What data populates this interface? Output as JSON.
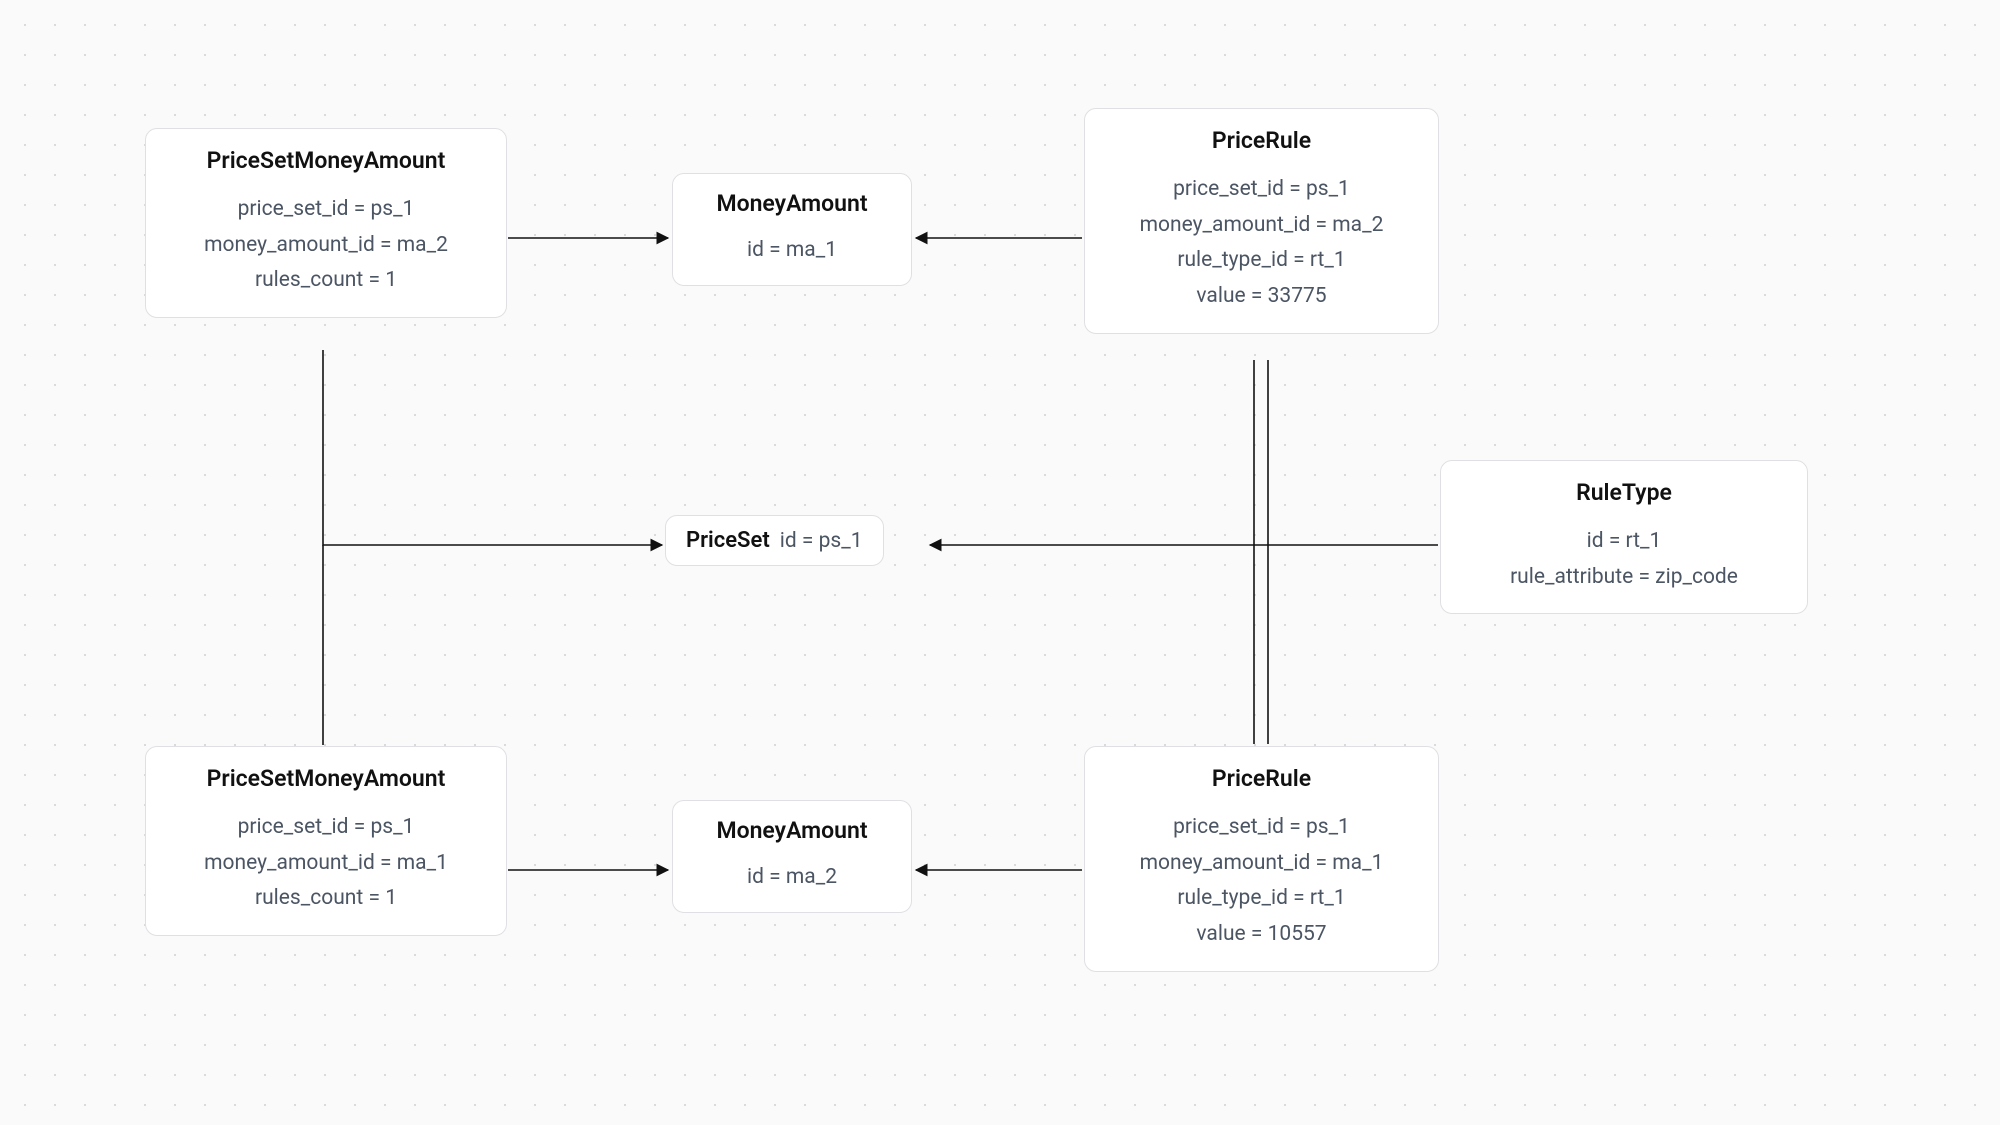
{
  "nodes": {
    "psma1": {
      "title": "PriceSetMoneyAmount",
      "attrs": {
        "price_set_id": "price_set_id = ps_1",
        "money_amount_id": "money_amount_id = ma_2",
        "rules_count": "rules_count = 1"
      }
    },
    "psma2": {
      "title": "PriceSetMoneyAmount",
      "attrs": {
        "price_set_id": "price_set_id = ps_1",
        "money_amount_id": "money_amount_id = ma_1",
        "rules_count": "rules_count = 1"
      }
    },
    "money1": {
      "title": "MoneyAmount",
      "attrs": {
        "id": "id = ma_1"
      }
    },
    "money2": {
      "title": "MoneyAmount",
      "attrs": {
        "id": "id = ma_2"
      }
    },
    "priceset": {
      "title": "PriceSet",
      "attrs": {
        "id": "id = ps_1"
      }
    },
    "pricerule1": {
      "title": "PriceRule",
      "attrs": {
        "price_set_id": "price_set_id = ps_1",
        "money_amount_id": "money_amount_id = ma_2",
        "rule_type_id": "rule_type_id = rt_1",
        "value": "value = 33775"
      }
    },
    "pricerule2": {
      "title": "PriceRule",
      "attrs": {
        "price_set_id": "price_set_id = ps_1",
        "money_amount_id": "money_amount_id = ma_1",
        "rule_type_id": "rule_type_id = rt_1",
        "value": "value = 10557"
      }
    },
    "ruletype": {
      "title": "RuleType",
      "attrs": {
        "id": "id = rt_1",
        "rule_attribute": "rule_attribute = zip_code"
      }
    }
  }
}
